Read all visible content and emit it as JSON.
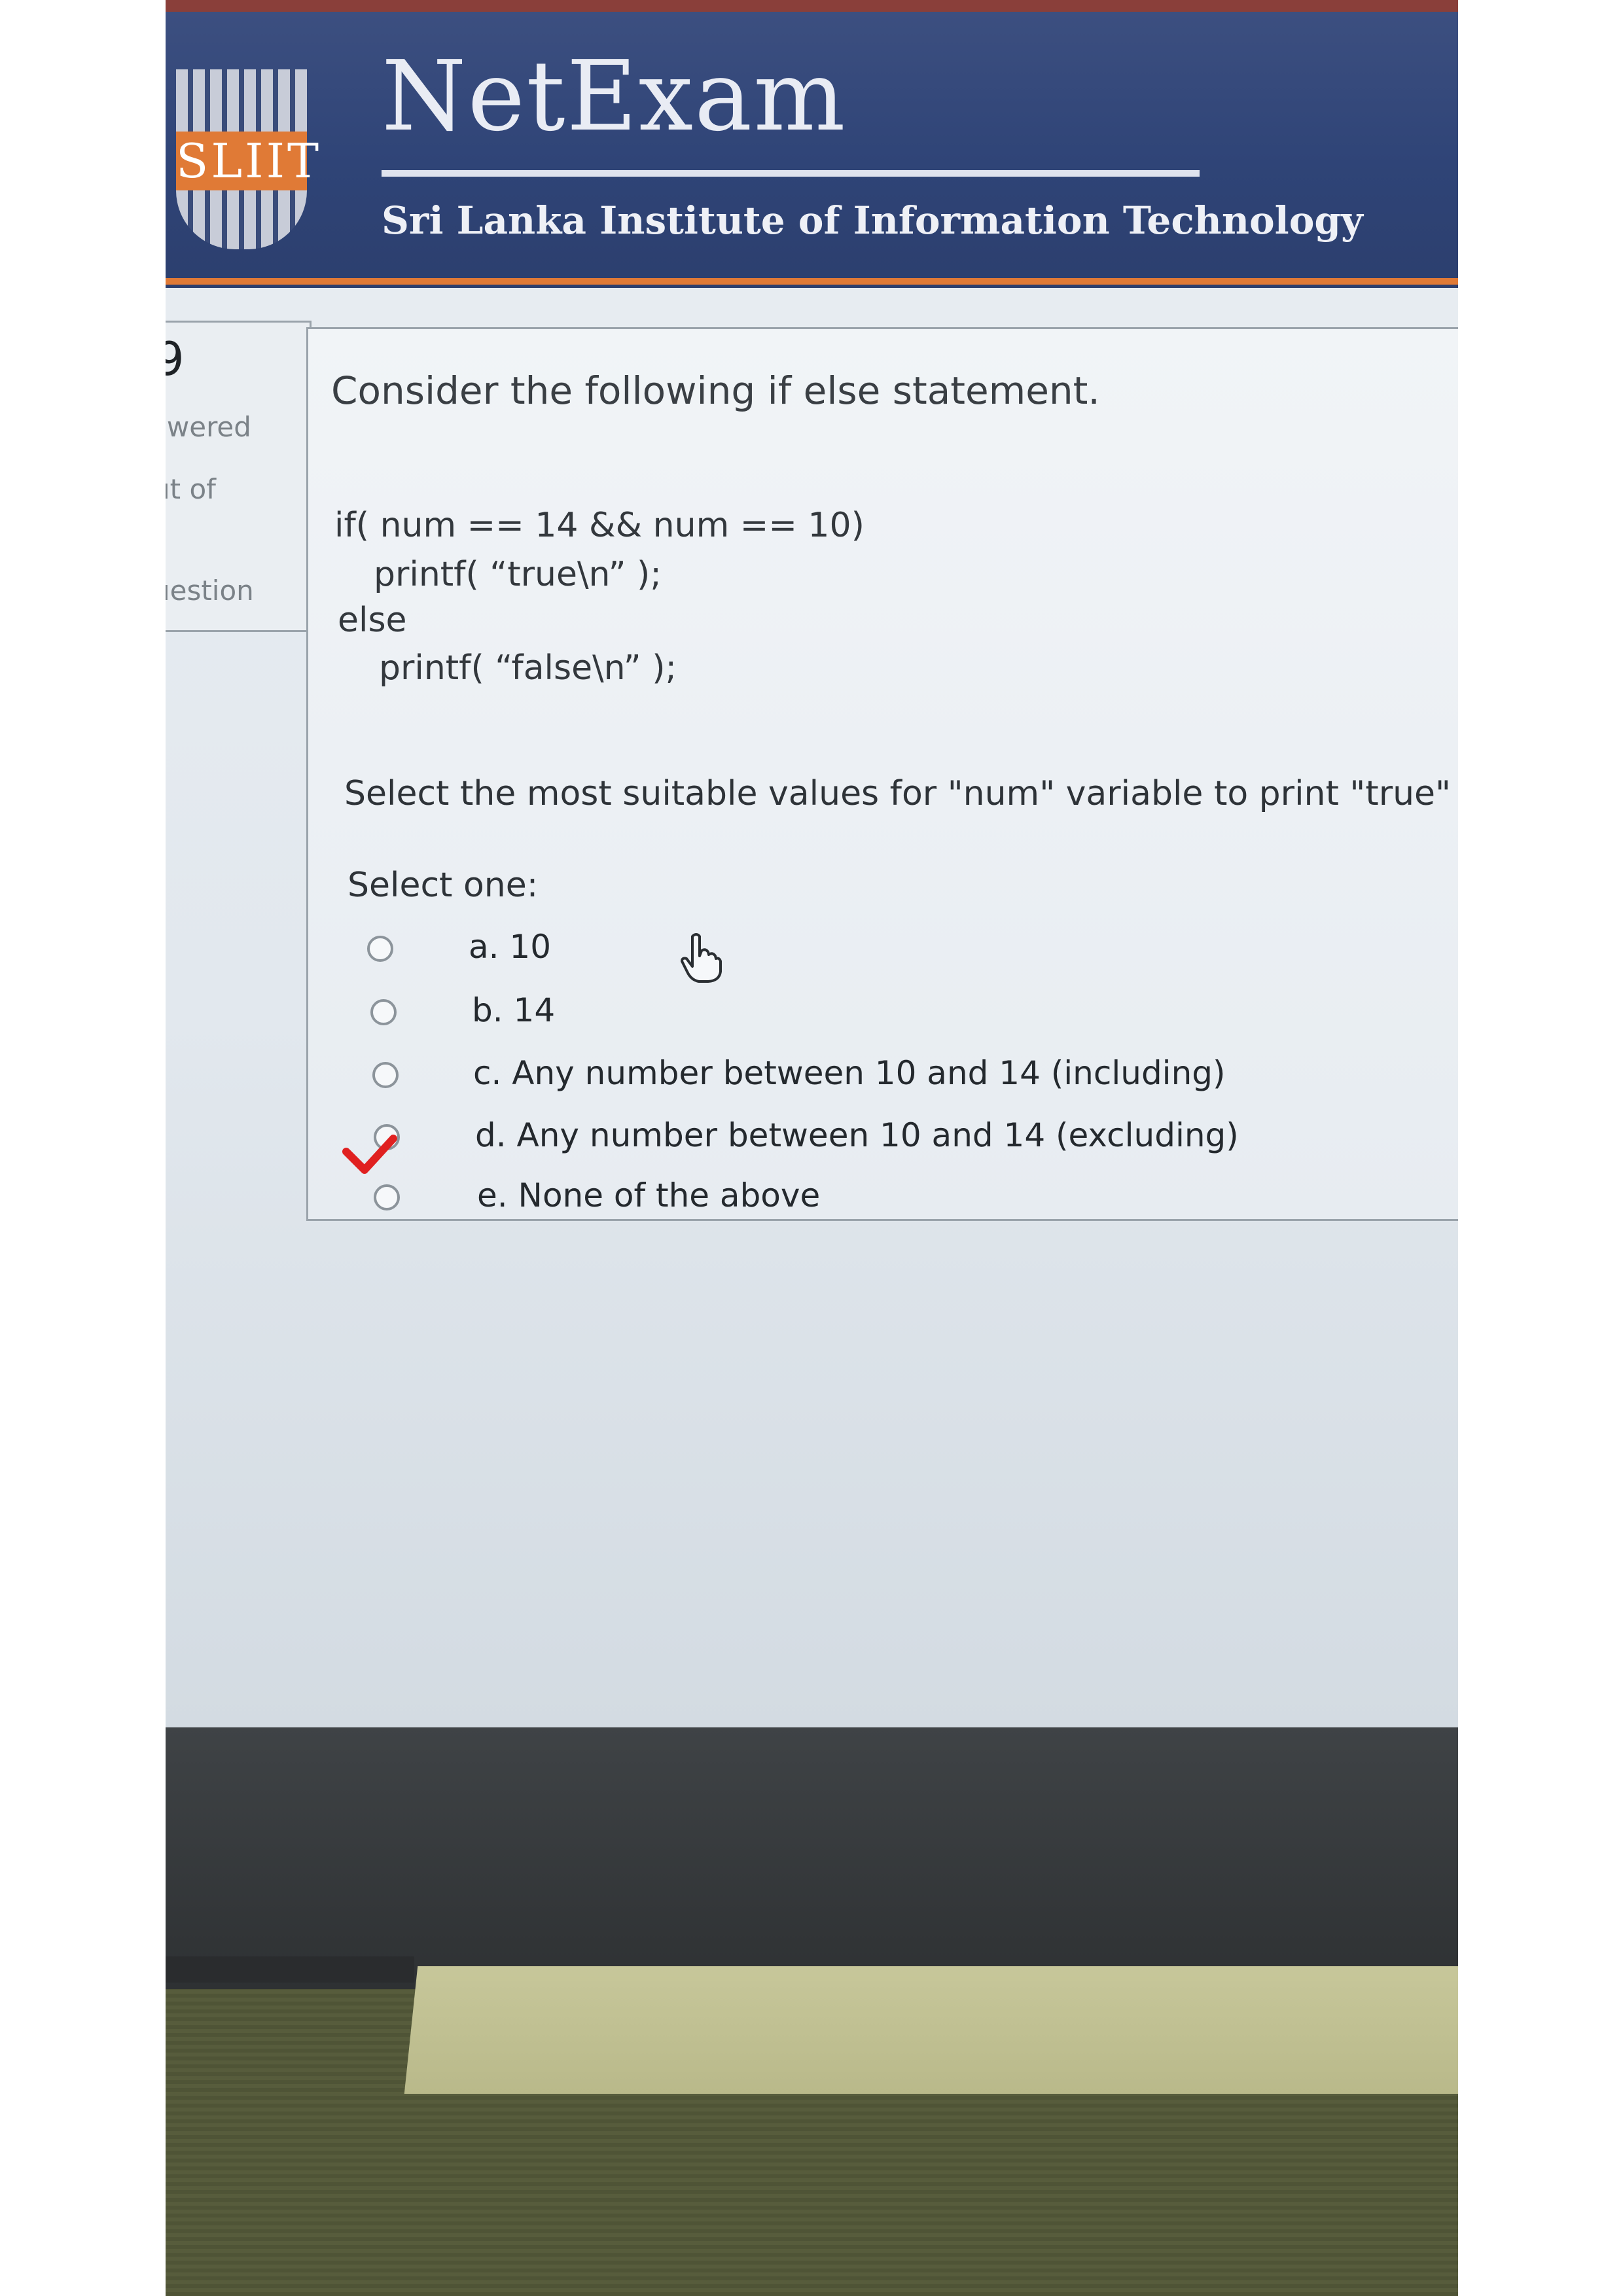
{
  "header": {
    "logo_text": "SLIIT",
    "app_title": "NetExam",
    "institute": "Sri Lanka Institute of Information Technology"
  },
  "nav": {
    "question_number": "9",
    "status_line": "swered",
    "marks_line": "ut of",
    "flag_line": "uestion"
  },
  "question": {
    "intro": "Consider the following if else statement.",
    "code": [
      "if( num == 14 && num == 10)",
      "printf( “true\\n” );",
      "else",
      "printf( “false\\n” );"
    ],
    "prompt": "Select the most suitable  values for \"num\" variable to print \"true\"",
    "select_label": "Select one:",
    "options": [
      {
        "label": "a. 10"
      },
      {
        "label": "b. 14"
      },
      {
        "label": "c. Any number between 10 and 14 (including)"
      },
      {
        "label": "d. Any number between 10 and 14 (excluding)"
      },
      {
        "label": "e. None of the above"
      }
    ],
    "annotated_option": "e"
  },
  "colors": {
    "header_bg": "#2f4477",
    "accent": "#e07a36",
    "checkmark": "#e02020"
  }
}
